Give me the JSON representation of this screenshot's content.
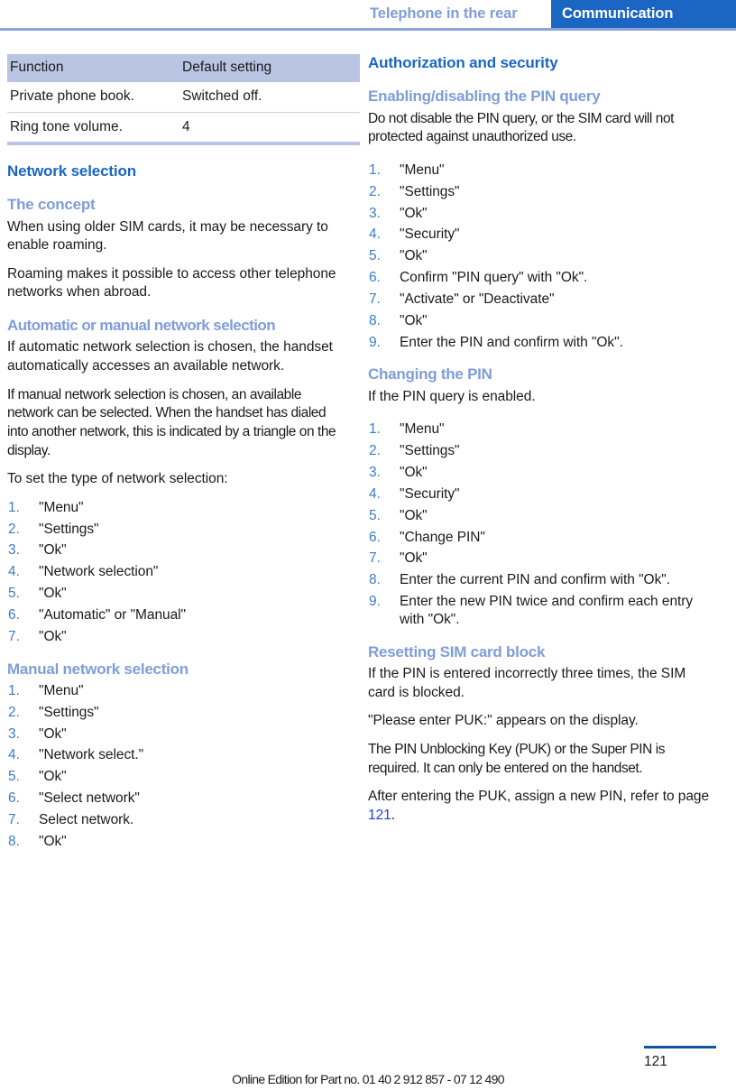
{
  "header": {
    "chapter": "Telephone in the rear",
    "section": "Communication",
    "accent_blue": "#1b66c2",
    "light_blue": "#7f9dd8"
  },
  "left_column": {
    "table": {
      "columns": [
        "Function",
        "Default setting"
      ],
      "rows": [
        [
          "Private phone book.",
          "Switched off."
        ],
        [
          "Ring tone volume.",
          "4"
        ]
      ]
    },
    "section_heading": "Network selection",
    "blocks": [
      {
        "type": "subheading",
        "text": "The concept"
      },
      {
        "type": "paragraph",
        "text": "When using older SIM cards, it may be necessary to enable roaming."
      },
      {
        "type": "paragraph",
        "text": "Roaming makes it possible to access other telephone networks when abroad."
      },
      {
        "type": "subheading",
        "text": "Automatic or manual network selection"
      },
      {
        "type": "paragraph",
        "text": "If automatic network selection is chosen, the handset automatically accesses an available network."
      },
      {
        "type": "paragraph",
        "text": "If manual network selection is chosen, an available network can be selected. When the handset has dialed into another network, this is indicated by a triangle on the display."
      },
      {
        "type": "paragraph",
        "text": "To set the type of network selection:"
      },
      {
        "type": "steps",
        "items": [
          "\"Menu\"",
          "\"Settings\"",
          "\"Ok\"",
          "\"Network selection\"",
          "\"Ok\"",
          "\"Automatic\" or \"Manual\"",
          "\"Ok\""
        ]
      },
      {
        "type": "subheading",
        "text": "Manual network selection"
      },
      {
        "type": "steps",
        "items": [
          "\"Menu\"",
          "\"Settings\"",
          "\"Ok\"",
          "\"Network select.\"",
          "\"Ok\"",
          "\"Select network\"",
          "Select network.",
          "\"Ok\""
        ]
      }
    ]
  },
  "right_column": {
    "section_heading": "Authorization and security",
    "blocks": [
      {
        "type": "subheading",
        "text": "Enabling/disabling the PIN query"
      },
      {
        "type": "paragraph",
        "text": "Do not disable the PIN query, or the SIM card will not protected against unauthorized use."
      },
      {
        "type": "steps",
        "items": [
          "\"Menu\"",
          "\"Settings\"",
          "\"Ok\"",
          "\"Security\"",
          "\"Ok\"",
          "Confirm \"PIN query\" with \"Ok\".",
          "\"Activate\" or \"Deactivate\"",
          "\"Ok\"",
          "Enter the PIN and confirm with \"Ok\"."
        ]
      },
      {
        "type": "subheading",
        "text": "Changing the PIN"
      },
      {
        "type": "paragraph",
        "text": "If the PIN query is enabled."
      },
      {
        "type": "steps",
        "items": [
          "\"Menu\"",
          "\"Settings\"",
          "\"Ok\"",
          "\"Security\"",
          "\"Ok\"",
          "\"Change PIN\"",
          "\"Ok\"",
          "Enter the current PIN and confirm with \"Ok\".",
          "Enter the new PIN twice and confirm each entry with \"Ok\"."
        ]
      },
      {
        "type": "subheading",
        "text": "Resetting SIM card block"
      },
      {
        "type": "paragraph",
        "text": "If the PIN is entered incorrectly three times, the SIM card is blocked."
      },
      {
        "type": "paragraph",
        "text": "\"Please enter PUK:\" appears on the display."
      },
      {
        "type": "paragraph",
        "text": "The PIN Unblocking Key (PUK) or the Super PIN is required. It can only be entered on the handset."
      },
      {
        "type": "paragraph_ref",
        "text_before": "After entering the PUK, assign a new PIN, refer to page ",
        "ref": "121",
        "text_after": "."
      }
    ]
  },
  "footer": {
    "note": "Online Edition for Part no. 01 40 2 912 857 - 07 12 490",
    "page_number": "121"
  }
}
